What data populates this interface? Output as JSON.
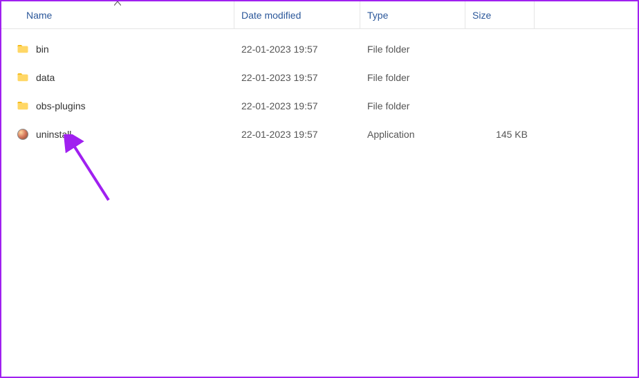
{
  "columns": {
    "name": "Name",
    "date": "Date modified",
    "type": "Type",
    "size": "Size"
  },
  "rows": [
    {
      "icon": "folder",
      "name": "bin",
      "date": "22-01-2023 19:57",
      "type": "File folder",
      "size": ""
    },
    {
      "icon": "folder",
      "name": "data",
      "date": "22-01-2023 19:57",
      "type": "File folder",
      "size": ""
    },
    {
      "icon": "folder",
      "name": "obs-plugins",
      "date": "22-01-2023 19:57",
      "type": "File folder",
      "size": ""
    },
    {
      "icon": "app",
      "name": "uninstall",
      "date": "22-01-2023 19:57",
      "type": "Application",
      "size": "145 KB"
    }
  ],
  "annotation_color": "#a020f0"
}
